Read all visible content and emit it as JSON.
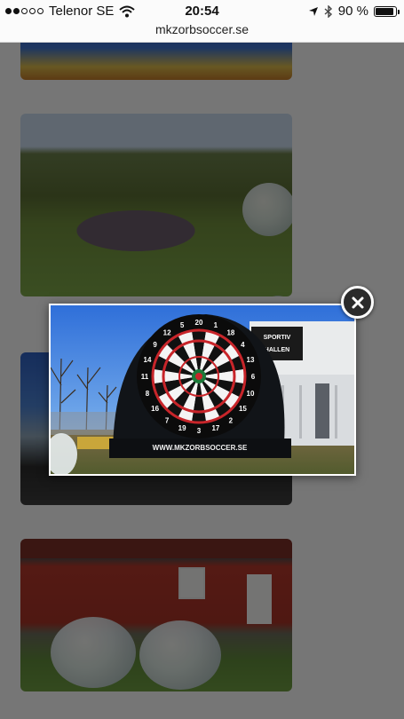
{
  "status_bar": {
    "carrier": "Telenor SE",
    "time": "20:54",
    "battery": "90 %",
    "battery_level": 0.9,
    "signal_bars": 2,
    "icons": [
      "wifi-icon",
      "location-arrow-icon",
      "bluetooth-icon",
      "battery-icon"
    ]
  },
  "browser": {
    "url": "mkzorbsoccer.se"
  },
  "lightbox": {
    "dartboard_numbers": [
      "20",
      "1",
      "18",
      "4",
      "13",
      "6",
      "10",
      "15",
      "2",
      "17",
      "3",
      "19",
      "7",
      "16",
      "8",
      "11",
      "14",
      "9",
      "12",
      "5"
    ],
    "banner_text": "WWW.MKZORBSOCCER.SE",
    "building_sign_lines": [
      "SPORTIV",
      "HALLEN"
    ]
  },
  "colors": {
    "overlay": "#000000",
    "close_button_bg": "#2b2b2b",
    "close_button_border": "#ffffff"
  }
}
